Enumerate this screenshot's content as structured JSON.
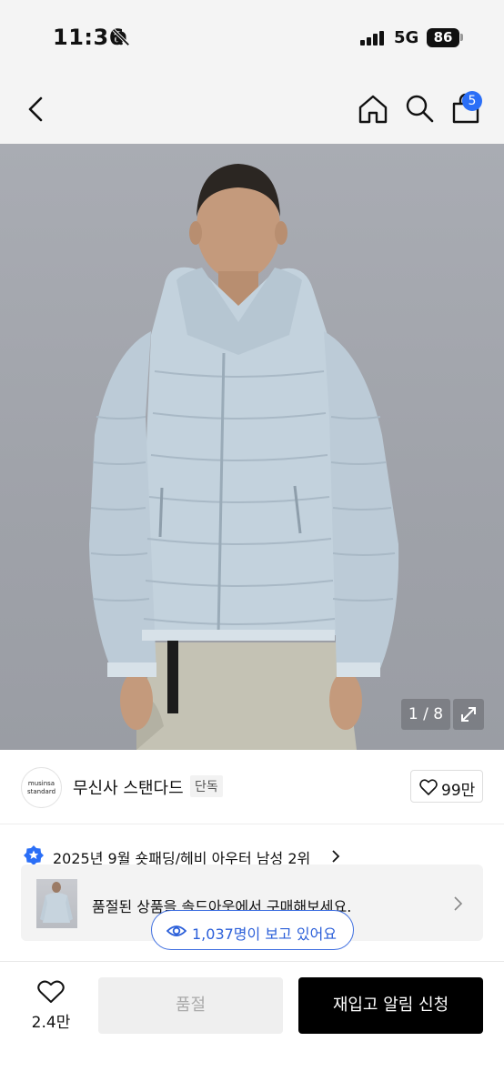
{
  "status_bar": {
    "time": "11:36",
    "network": "5G",
    "battery": "86"
  },
  "nav": {
    "cart_count": "5"
  },
  "gallery": {
    "counter": "1 / 8"
  },
  "brand": {
    "logo_text_line1": "musinsa",
    "logo_text_line2": "standard",
    "name": "무신사 스탠다드",
    "tag": "단독",
    "like_count": "99만"
  },
  "ranking": {
    "text": "2025년 9월 숏패딩/헤비 아우터 남성 2위"
  },
  "soldout_card": {
    "text": "품절된 상품을 솔드아웃에서 구매해보세요."
  },
  "viewers": {
    "text": "1,037명이 보고 있어요"
  },
  "bottom_bar": {
    "wish_count": "2.4만",
    "soldout_label": "품절",
    "restock_label": "재입고 알림 신청"
  },
  "colors": {
    "accent_blue": "#2b6ff7",
    "jacket": "#c3d2dd",
    "background_gray": "#a3a6ad"
  }
}
